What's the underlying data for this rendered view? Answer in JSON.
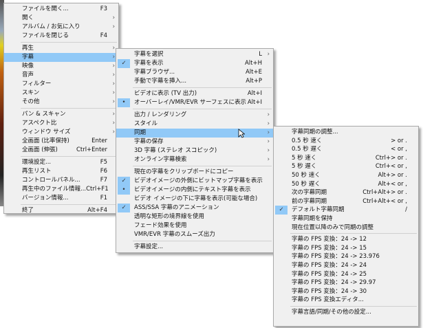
{
  "main_menu": [
    {
      "label": "ファイルを開く...",
      "shortcut": "F3"
    },
    {
      "label": "開く",
      "submenu": true
    },
    {
      "label": "アルバム / お気に入り",
      "submenu": true
    },
    {
      "label": "ファイルを閉じる",
      "shortcut": "F4"
    },
    {
      "sep": true
    },
    {
      "label": "再生",
      "submenu": true
    },
    {
      "label": "字幕",
      "submenu": true,
      "highlighted": true
    },
    {
      "label": "映像",
      "submenu": true
    },
    {
      "label": "音声",
      "submenu": true
    },
    {
      "label": "フィルター",
      "submenu": true
    },
    {
      "label": "スキン",
      "submenu": true
    },
    {
      "label": "その他",
      "submenu": true
    },
    {
      "sep": true
    },
    {
      "label": "パン & スキャン",
      "submenu": true
    },
    {
      "label": "アスペクト比",
      "submenu": true
    },
    {
      "label": "ウィンドウ サイズ",
      "submenu": true
    },
    {
      "label": "全画面 (比率保持)",
      "shortcut": "Enter"
    },
    {
      "label": "全画面 (伸張)",
      "shortcut": "Ctrl+Enter"
    },
    {
      "sep": true
    },
    {
      "label": "環境設定...",
      "shortcut": "F5"
    },
    {
      "label": "再生リスト",
      "shortcut": "F6"
    },
    {
      "label": "コントロールパネル...",
      "shortcut": "F7"
    },
    {
      "label": "再生中のファイル情報...",
      "shortcut": "Ctrl+F1"
    },
    {
      "label": "バージョン情報...",
      "shortcut": "F1"
    },
    {
      "sep": true
    },
    {
      "label": "終了",
      "shortcut": "Alt+F4"
    }
  ],
  "subtitle_menu": [
    {
      "label": "字幕を選択",
      "shortcut": "L",
      "submenu": true
    },
    {
      "label": "字幕を表示",
      "shortcut": "Alt+H",
      "mark": "check"
    },
    {
      "label": "字幕ブラウザ...",
      "shortcut": "Alt+E"
    },
    {
      "label": "手動で字幕を挿入...",
      "shortcut": "Alt+P"
    },
    {
      "sep": true
    },
    {
      "label": "ビデオに表示 (TV 出力)",
      "shortcut": "Alt+I"
    },
    {
      "label": "オーバーレイ/VMR/EVR サーフェスに表示",
      "shortcut": "Alt+I",
      "mark": "dot"
    },
    {
      "sep": true
    },
    {
      "label": "出力 / レンダリング",
      "submenu": true
    },
    {
      "label": "スタイル",
      "submenu": true
    },
    {
      "label": "同期",
      "submenu": true,
      "highlighted": true
    },
    {
      "label": "字幕の保存",
      "submenu": true
    },
    {
      "label": "3D 字幕 (ステレオ スコピック)",
      "submenu": true
    },
    {
      "label": "オンライン字幕検索",
      "submenu": true
    },
    {
      "sep": true
    },
    {
      "label": "現在の字幕をクリップボードにコピー"
    },
    {
      "label": "ビデオイメージの外側にビットマップ字幕を表示",
      "mark": "check"
    },
    {
      "label": "ビデオイメージの内側にテキスト字幕を表示",
      "mark": "dot"
    },
    {
      "label": "ビデオ イメージの下に字幕を表示(可能な場合)"
    },
    {
      "label": "ASS/SSA 字幕のアニメーション",
      "mark": "check"
    },
    {
      "label": "透明な矩形の境界線を使用"
    },
    {
      "label": "フェード効果を使用"
    },
    {
      "label": "VMR/EVR 字幕のスムーズ出力"
    },
    {
      "sep": true
    },
    {
      "label": "字幕設定..."
    }
  ],
  "sync_menu": [
    {
      "label": "字幕同期の調整..."
    },
    {
      "label": "0.5 秒 速く",
      "shortcut": "> or ."
    },
    {
      "label": "0.5 秒 遅く",
      "shortcut": "< or ,"
    },
    {
      "label": "5 秒 速く",
      "shortcut": "Ctrl+> or ."
    },
    {
      "label": "5 秒 遅く",
      "shortcut": "Ctrl+< or ,"
    },
    {
      "label": "50 秒 速く",
      "shortcut": "Alt+> or ."
    },
    {
      "label": "50 秒 遅く",
      "shortcut": "Alt+< or ,"
    },
    {
      "label": "次の字幕同期",
      "shortcut": "Ctrl+Alt+> or ."
    },
    {
      "label": "前の字幕同期",
      "shortcut": "Ctrl+Alt+< or ,"
    },
    {
      "label": "デフォルト字幕同期",
      "shortcut": "/",
      "mark": "check"
    },
    {
      "label": "字幕同期を保持"
    },
    {
      "label": "現在位置以降のみで同期の調整"
    },
    {
      "sep": true
    },
    {
      "label": "字幕の FPS 変換：24 -> 12"
    },
    {
      "label": "字幕の FPS 変換：24 -> 15"
    },
    {
      "label": "字幕の FPS 変換：24 -> 23.976"
    },
    {
      "label": "字幕の FPS 変換：24 -> 24"
    },
    {
      "label": "字幕の FPS 変換：24 -> 25"
    },
    {
      "label": "字幕の FPS 変換：24 -> 29.97"
    },
    {
      "label": "字幕の FPS 変換：24 -> 30"
    },
    {
      "label": "字幕の FPS 変換エディタ..."
    },
    {
      "sep": true
    },
    {
      "label": "字幕言語/同期/その他の設定..."
    }
  ],
  "colors": {
    "highlight": "#91c9f7",
    "menu_bg": "#f0f0f0"
  }
}
